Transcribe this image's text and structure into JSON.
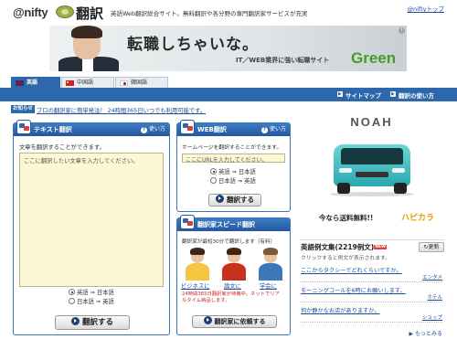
{
  "header": {
    "logo": "@nifty",
    "product": "翻訳",
    "tagline": "英語Web翻訳総合サイト。無料翻訳や各分野の専門翻訳家サービスが充実",
    "top_link": "@niftyトップ"
  },
  "banner": {
    "headline": "転職しちゃいな。",
    "sub": "IT／WEB業界に強い転職サイト",
    "brand": "Green"
  },
  "tabs": [
    {
      "label": "英語",
      "flag": "uk-flag-icon",
      "active": true
    },
    {
      "label": "中国語",
      "flag": "china-flag-icon",
      "active": false
    },
    {
      "label": "韓国語",
      "flag": "korea-flag-icon",
      "active": false
    }
  ],
  "nav": {
    "sitemap": "サイトマップ",
    "howto": "翻訳の使い方"
  },
  "notice": {
    "badge": "お知らせ",
    "text": "プロの翻訳家に簡単発注！ 24時間365日いつでも利用可能です。"
  },
  "text_translation": {
    "title": "テキスト翻訳",
    "help": "使い方",
    "desc": "文章を翻訳することができます。",
    "placeholder": "ここに翻訳したい文章を入力してください。",
    "radio_en_ja": "英語 ⇒ 日本語",
    "radio_ja_en": "日本語 ⇒ 英語",
    "button": "翻訳する"
  },
  "web_translation": {
    "title": "WEB翻訳",
    "help": "使い方",
    "desc": "ホームページを翻訳することができます。",
    "placeholder": "ここにURLを入力してください。",
    "radio_en_ja": "英語 ⇒ 日本語",
    "radio_ja_en": "日本語 ⇒ 英語",
    "button": "翻訳する"
  },
  "speed_translation": {
    "title": "翻訳家スピード翻訳",
    "help": "使い方",
    "desc": "翻訳家が最短30分で翻訳します（有料）",
    "labels": [
      "ビジネスに",
      "論文に",
      "学会に"
    ],
    "note_line1": "24時間365日翻訳家が待機中。ネットでリア",
    "note_line2": "ルタイム納品します。",
    "button": "翻訳家に依頼する"
  },
  "ad": {
    "model": "NOAH",
    "copy": "今なら送料無料!!",
    "brand": "ハピカラ"
  },
  "examples": {
    "title": "英語例文集",
    "count": "(2219例文)",
    "new_badge": "NEW",
    "refresh": "更新",
    "subtitle": "クリックすると例文が表示されます。",
    "items": [
      {
        "text": "ここからタクシーでどれくらいですか。",
        "meta": "エンタメ"
      },
      {
        "text": "モーニングコールを6時にお願いします。",
        "meta": "ホテル"
      },
      {
        "text": "何か静かなお店がありますか。",
        "meta": "ショップ"
      }
    ],
    "more": "もっとみる"
  },
  "colors": {
    "brand_blue": "#2e68ac",
    "link": "#1a4fa0",
    "input_bg": "#fcf8d6",
    "alert_red": "#cc2222"
  }
}
